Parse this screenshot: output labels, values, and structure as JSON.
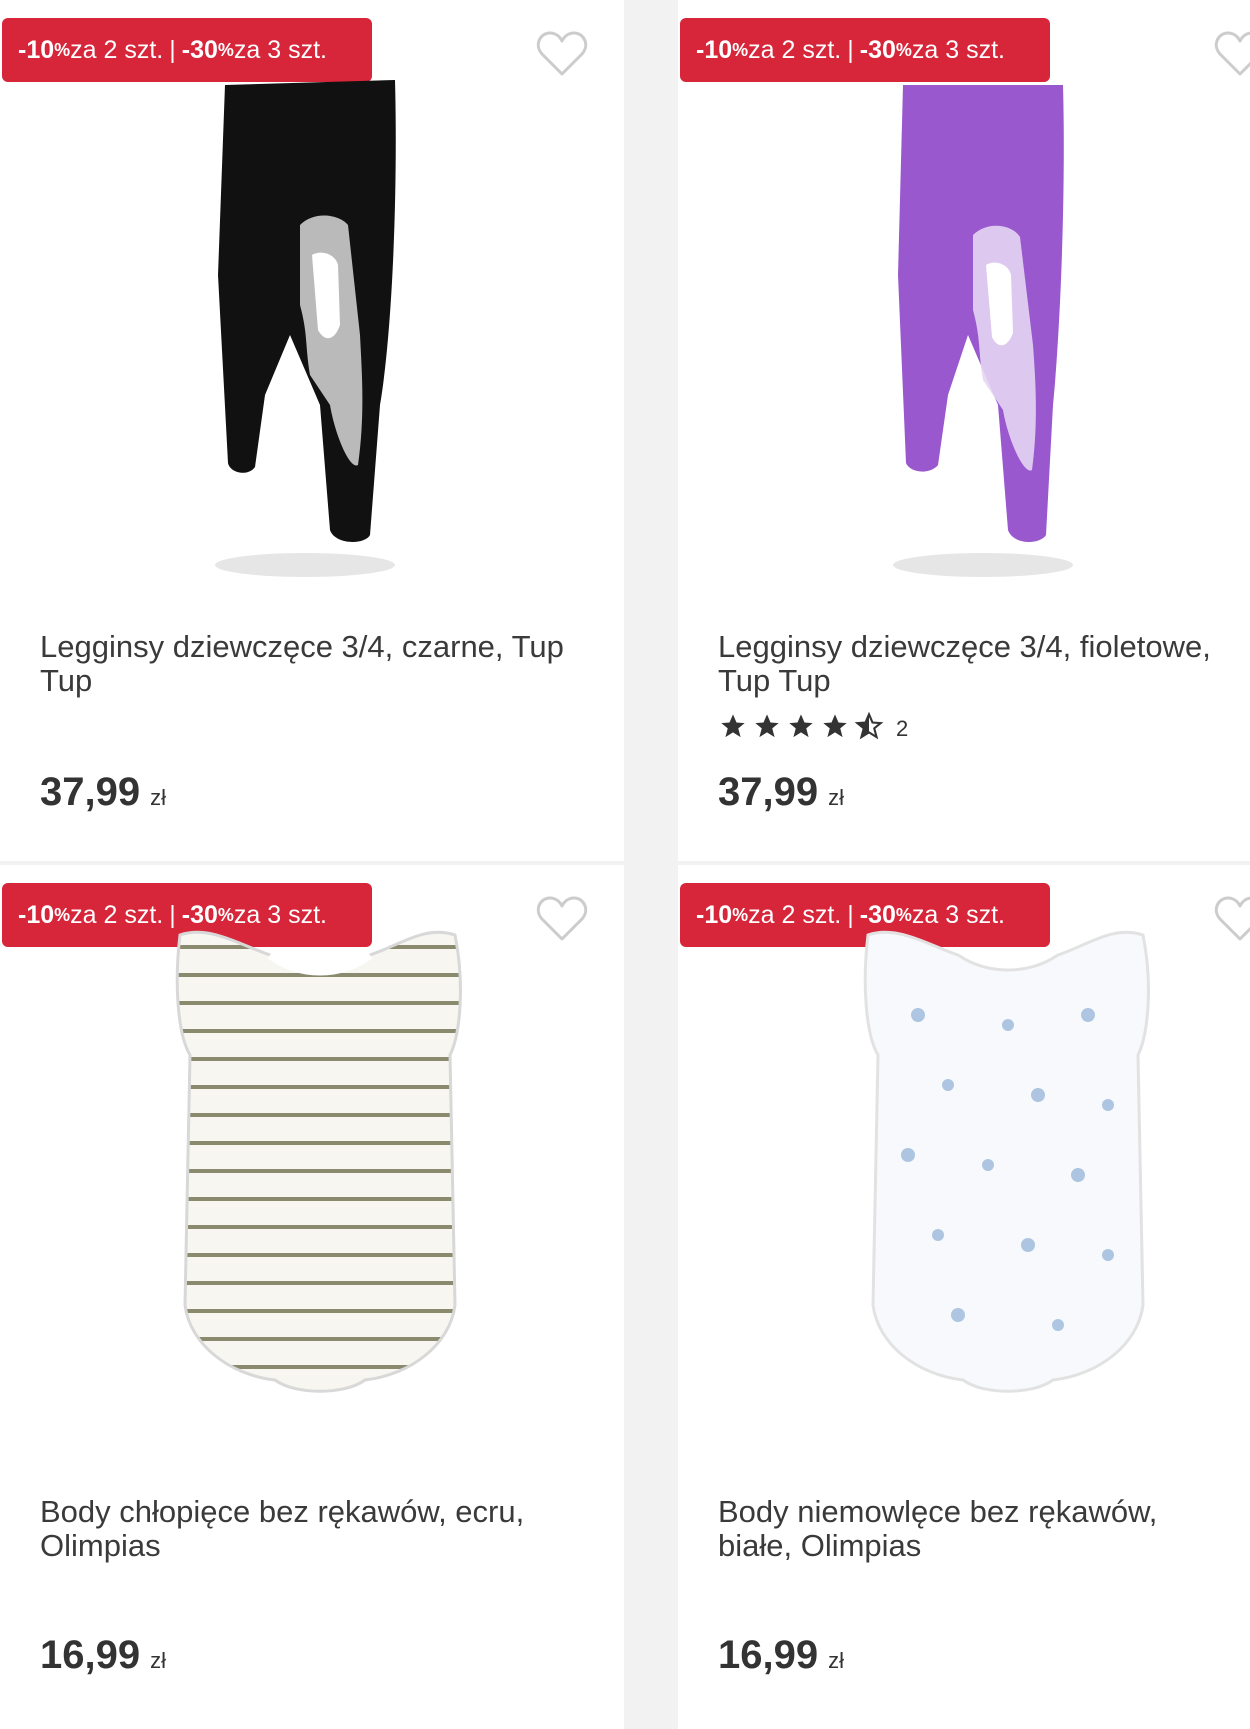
{
  "products": [
    {
      "badge": {
        "d1": "-10",
        "p1": "%",
        "t1": " za 2 szt.",
        "d2": "-30",
        "p2": "%",
        "t2": " za 3 szt."
      },
      "title": "Legginsy dziewczęce 3/4, czarne, Tup Tup",
      "price": "37,99",
      "currency": "zł",
      "color": "#111111"
    },
    {
      "badge": {
        "d1": "-10",
        "p1": "%",
        "t1": " za 2 szt.",
        "d2": "-30",
        "p2": "%",
        "t2": " za 3 szt."
      },
      "title": "Legginsy dziewczęce 3/4, fioletowe, Tup Tup",
      "rating": 4.5,
      "rating_count": "2",
      "price": "37,99",
      "currency": "zł",
      "color": "#9a58cf"
    },
    {
      "badge": {
        "d1": "-10",
        "p1": "%",
        "t1": " za 2 szt.",
        "d2": "-30",
        "p2": "%",
        "t2": " za 3 szt."
      },
      "title": "Body chłopięce bez rękawów, ecru, Olimpias",
      "price": "16,99",
      "currency": "zł",
      "color": "#8a8a6e"
    },
    {
      "badge": {
        "d1": "-10",
        "p1": "%",
        "t1": " za 2 szt.",
        "d2": "-30",
        "p2": "%",
        "t2": " za 3 szt."
      },
      "title": "Body niemowlęce bez rękawów, białe, Olimpias",
      "price": "16,99",
      "currency": "zł",
      "color": "#8fb0d6"
    }
  ],
  "colors": {
    "badge": "#d7253a",
    "heart": "#cccccc",
    "star": "#333333"
  }
}
